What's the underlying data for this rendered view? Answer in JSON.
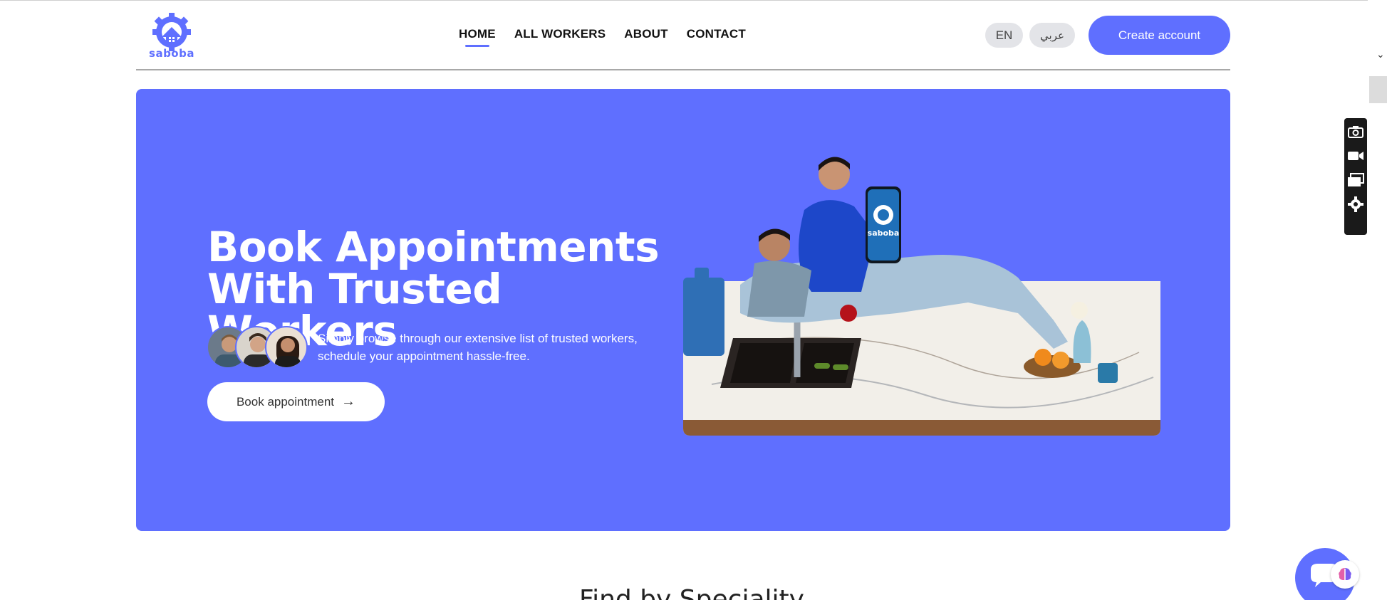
{
  "header": {
    "logo_text": "saboba",
    "nav": [
      {
        "label": "HOME",
        "active": true
      },
      {
        "label": "ALL WORKERS",
        "active": false
      },
      {
        "label": "ABOUT",
        "active": false
      },
      {
        "label": "CONTACT",
        "active": false
      }
    ],
    "lang_en": "EN",
    "lang_ar": "عربي",
    "create_account": "Create account"
  },
  "hero": {
    "title_line1": "Book Appointments",
    "title_line2": "With Trusted Workers",
    "description": "Simply browse through our extensive list of trusted workers, schedule your appointment hassle-free.",
    "book_button": "Book appointment",
    "phone_brand": "saboba"
  },
  "section": {
    "title": "Find by Speciality"
  },
  "tools": [
    "camera-icon",
    "video-icon",
    "windows-icon",
    "gear-icon"
  ],
  "colors": {
    "accent": "#5f6fff",
    "white": "#ffffff"
  }
}
